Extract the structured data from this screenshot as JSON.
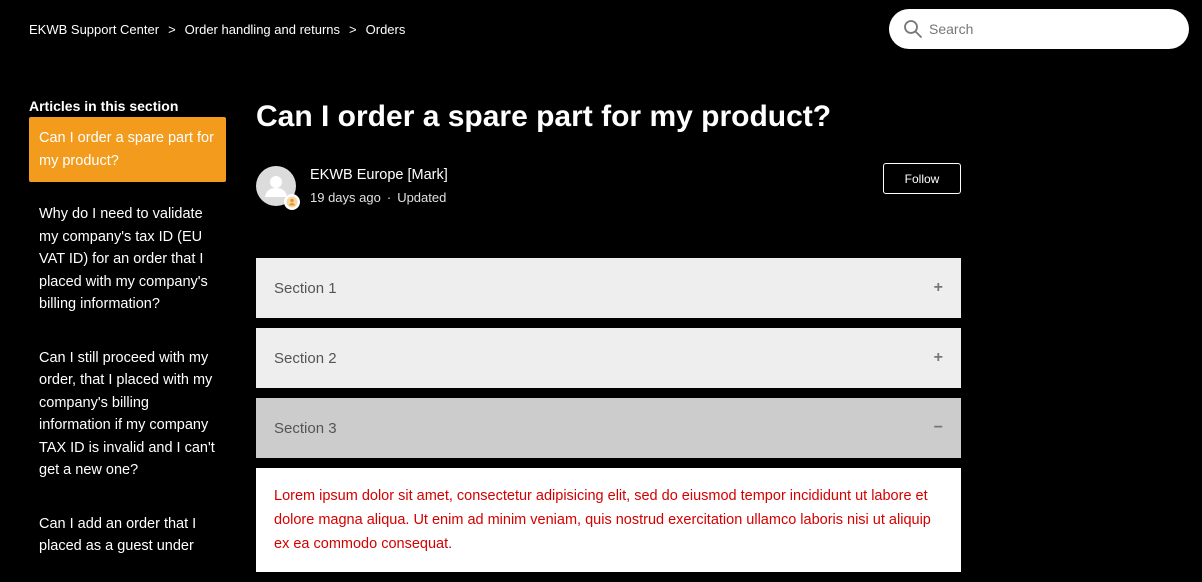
{
  "breadcrumb": {
    "items": [
      "EKWB Support Center",
      "Order handling and returns",
      "Orders"
    ],
    "separator": ">"
  },
  "search": {
    "placeholder": "Search",
    "icon": "search-icon"
  },
  "sidebar": {
    "title": "Articles in this section",
    "items": [
      {
        "label": "Can I order a spare part for my product?",
        "active": true
      },
      {
        "label": "Why do I need to validate my company's tax ID (EU VAT ID) for an order that I placed with my company's billing information?",
        "active": false
      },
      {
        "label": "Can I still proceed with my order, that I placed with my company's billing information if my company TAX ID is invalid and I can't get a new one?",
        "active": false
      },
      {
        "label": "Can I add an order that I placed as a guest under",
        "active": false
      }
    ]
  },
  "article": {
    "title": "Can I order a spare part for my product?",
    "author": {
      "name": "EKWB Europe [Mark]",
      "time": "19 days ago",
      "separator": "·",
      "status": "Updated"
    },
    "follow_label": "Follow"
  },
  "accordion": {
    "sections": [
      {
        "label": "Section 1",
        "toggle": "+"
      },
      {
        "label": "Section 2",
        "toggle": "+"
      },
      {
        "label": "Section 3",
        "toggle": "−"
      }
    ],
    "panel_text": "Lorem ipsum dolor sit amet, consectetur adipisicing elit, sed do eiusmod tempor incididunt ut labore et dolore magna aliqua. Ut enim ad minim veniam, quis nostrud exercitation ullamco laboris nisi ut aliquip ex ea commodo consequat."
  },
  "colors": {
    "background": "#000000",
    "accent": "#f29b1d",
    "panel_text": "#d40000"
  }
}
